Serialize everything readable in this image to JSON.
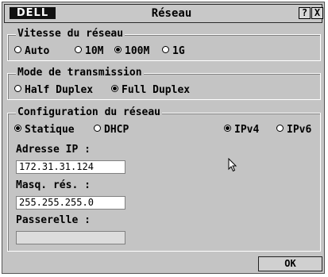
{
  "window": {
    "brand": "DELL",
    "title": "Réseau",
    "help_label": "?",
    "close_label": "X"
  },
  "speed_group": {
    "legend": "Vitesse du réseau",
    "options": [
      "Auto",
      "10M",
      "100M",
      "1G"
    ],
    "selected": "100M"
  },
  "duplex_group": {
    "legend": "Mode de transmission",
    "options": [
      "Half Duplex",
      "Full Duplex"
    ],
    "selected": "Full Duplex"
  },
  "config_group": {
    "legend": "Configuration du réseau",
    "mode_options": [
      "Statique",
      "DHCP"
    ],
    "mode_selected": "Statique",
    "ip_version_options": [
      "IPv4",
      "IPv6"
    ],
    "ip_version_selected": "IPv4",
    "ip_label": "Adresse IP :",
    "ip_value": "172.31.31.124",
    "mask_label": "Masq. rés. :",
    "mask_value": "255.255.255.0",
    "gateway_label": "Passerelle :",
    "gateway_value": ""
  },
  "buttons": {
    "ok_label": "OK"
  }
}
